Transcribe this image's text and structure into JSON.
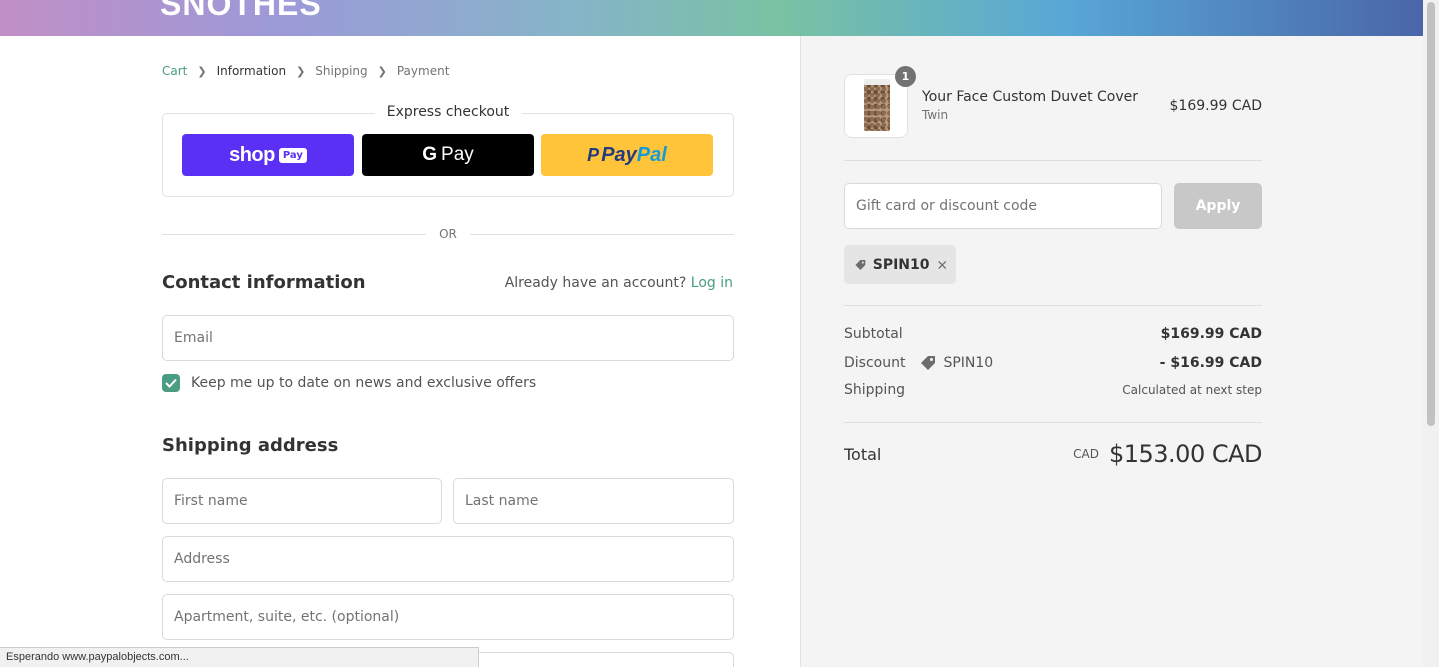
{
  "banner": {
    "logo_text": "SNOTHES"
  },
  "breadcrumb": {
    "items": [
      "Cart",
      "Information",
      "Shipping",
      "Payment"
    ],
    "active": "Information"
  },
  "express": {
    "title": "Express checkout",
    "shoppay_text": "shop",
    "shoppay_badge": "Pay",
    "gpay_g": "G",
    "gpay_text": "Pay",
    "paypal_p": "P",
    "paypal_1": "Pay",
    "paypal_2": "Pal"
  },
  "or_text": "OR",
  "contact": {
    "title": "Contact information",
    "account_prompt": "Already have an account?",
    "login_link": "Log in",
    "email_placeholder": "Email",
    "newsletter_label": "Keep me up to date on news and exclusive offers",
    "newsletter_checked": true
  },
  "shipping": {
    "title": "Shipping address",
    "first_name_placeholder": "First name",
    "last_name_placeholder": "Last name",
    "address_placeholder": "Address",
    "apartment_placeholder": "Apartment, suite, etc. (optional)"
  },
  "status_bar": "Esperando www.paypalobjects.com...",
  "order": {
    "product_name": "Your Face Custom Duvet Cover",
    "product_variant": "Twin",
    "product_price": "$169.99 CAD",
    "quantity": "1",
    "discount_placeholder": "Gift card or discount code",
    "apply_label": "Apply",
    "applied_code": "SPIN10",
    "subtotal_label": "Subtotal",
    "subtotal_value": "$169.99 CAD",
    "discount_label": "Discount",
    "discount_code": "SPIN10",
    "discount_value": "- $16.99 CAD",
    "shipping_label": "Shipping",
    "shipping_value": "Calculated at next step",
    "total_label": "Total",
    "total_currency": "CAD",
    "total_value": "$153.00 CAD"
  },
  "colors": {
    "accent": "#4a9c82",
    "shoppay": "#5a31f4",
    "paypal": "#ffc439"
  }
}
